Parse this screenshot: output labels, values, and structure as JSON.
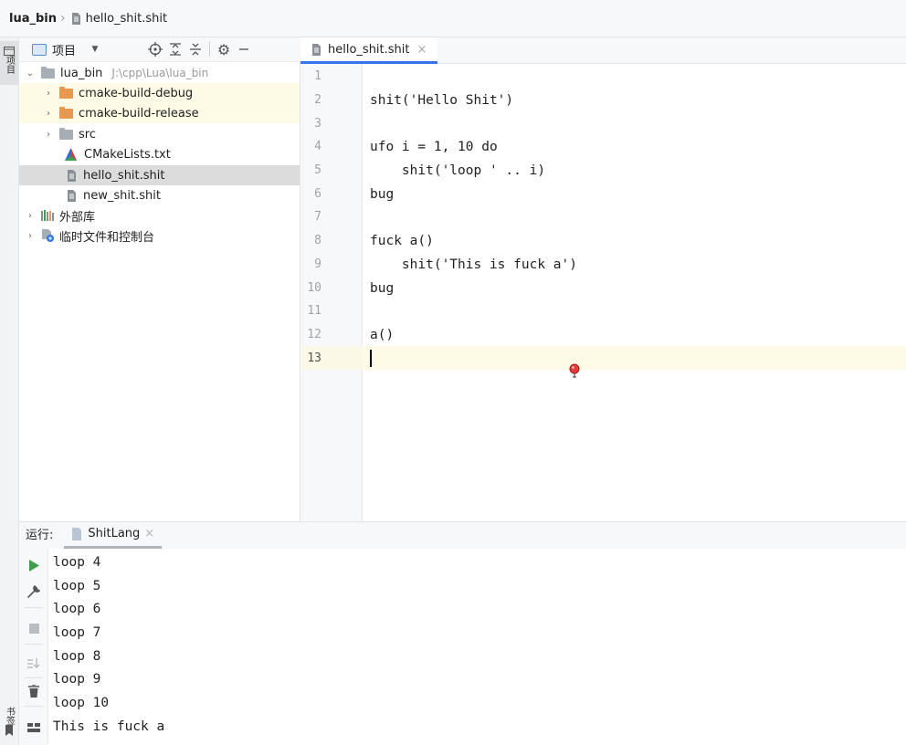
{
  "breadcrumb": {
    "project": "lua_bin",
    "file": "hello_shit.shit"
  },
  "left_strip": {
    "project_tab": "项目",
    "bookmarks_tab": "书签"
  },
  "project_panel": {
    "view_label": "项目"
  },
  "tree": [
    {
      "label": "lua_bin",
      "hint": "J:\\cpp\\Lua\\lua_bin",
      "icon": "folder-gray-icon"
    },
    {
      "label": "cmake-build-debug",
      "icon": "folder-orange-icon"
    },
    {
      "label": "cmake-build-release",
      "icon": "folder-orange-icon"
    },
    {
      "label": "src",
      "icon": "folder-gray-icon"
    },
    {
      "label": "CMakeLists.txt",
      "icon": "cmake-icon"
    },
    {
      "label": "hello_shit.shit",
      "icon": "file-icon"
    },
    {
      "label": "new_shit.shit",
      "icon": "file-icon"
    },
    {
      "label": "外部库",
      "icon": "library-icon"
    },
    {
      "label": "临时文件和控制台",
      "icon": "scratch-icon"
    }
  ],
  "editor": {
    "tab_label": "hello_shit.shit",
    "line_numbers": [
      "1",
      "2",
      "3",
      "4",
      "5",
      "6",
      "7",
      "8",
      "9",
      "10",
      "11",
      "12",
      "13"
    ],
    "lines": [
      "",
      "shit('Hello Shit')",
      "",
      "ufo i = 1, 10 do",
      "    shit('loop ' .. i)",
      "bug",
      "",
      "fuck a()",
      "    shit('This is fuck a')",
      "bug",
      "",
      "a()",
      ""
    ]
  },
  "run": {
    "label": "运行:",
    "tab_label": "ShitLang",
    "output": [
      "loop 4",
      "loop 5",
      "loop 6",
      "loop 7",
      "loop 8",
      "loop 9",
      "loop 10",
      "This is fuck a"
    ]
  },
  "colors": {
    "accent": "#3574f0",
    "folder_orange": "#e8994f",
    "current_line": "#fdfbe6",
    "run_green": "#3f9c4d"
  }
}
